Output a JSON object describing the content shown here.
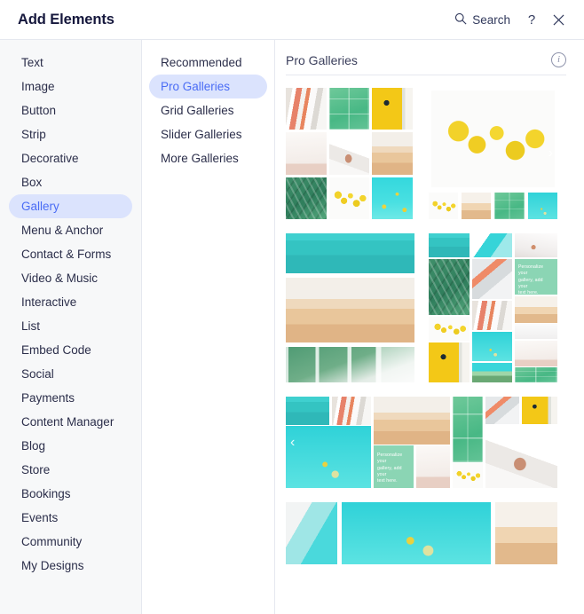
{
  "header": {
    "title": "Add Elements",
    "search_label": "Search",
    "search_icon": "search-icon",
    "help_label": "?",
    "close_label": "×"
  },
  "categories": [
    {
      "label": "Text",
      "selected": false
    },
    {
      "label": "Image",
      "selected": false
    },
    {
      "label": "Button",
      "selected": false
    },
    {
      "label": "Strip",
      "selected": false
    },
    {
      "label": "Decorative",
      "selected": false
    },
    {
      "label": "Box",
      "selected": false
    },
    {
      "label": "Gallery",
      "selected": true
    },
    {
      "label": "Menu & Anchor",
      "selected": false
    },
    {
      "label": "Contact & Forms",
      "selected": false
    },
    {
      "label": "Video & Music",
      "selected": false
    },
    {
      "label": "Interactive",
      "selected": false
    },
    {
      "label": "List",
      "selected": false
    },
    {
      "label": "Embed Code",
      "selected": false
    },
    {
      "label": "Social",
      "selected": false
    },
    {
      "label": "Payments",
      "selected": false
    },
    {
      "label": "Content Manager",
      "selected": false
    },
    {
      "label": "Blog",
      "selected": false
    },
    {
      "label": "Store",
      "selected": false
    },
    {
      "label": "Bookings",
      "selected": false
    },
    {
      "label": "Events",
      "selected": false
    },
    {
      "label": "Community",
      "selected": false
    },
    {
      "label": "My Designs",
      "selected": false
    }
  ],
  "subcategories": [
    {
      "label": "Recommended",
      "selected": false
    },
    {
      "label": "Pro Galleries",
      "selected": true
    },
    {
      "label": "Grid Galleries",
      "selected": false
    },
    {
      "label": "Slider Galleries",
      "selected": false
    },
    {
      "label": "More Galleries",
      "selected": false
    }
  ],
  "content": {
    "title": "Pro Galleries",
    "info_icon": "info-icon"
  },
  "galleries": [
    {
      "name": "grid-3x3-gallery",
      "layout": "half"
    },
    {
      "name": "slider-with-thumbnails-gallery",
      "layout": "half"
    },
    {
      "name": "stacked-rows-gallery",
      "layout": "half"
    },
    {
      "name": "masonry-columns-gallery",
      "layout": "half"
    },
    {
      "name": "wide-collage-gallery",
      "layout": "full"
    },
    {
      "name": "wide-strip-gallery",
      "layout": "full"
    }
  ],
  "placeholder_text": {
    "line1": "Personalize your",
    "line2": "gallery, add your",
    "line3": "text here."
  },
  "colors": {
    "accent": "#4a6cf5",
    "accent_pill": "#dbe3fd",
    "text": "#2b2e4a",
    "sidebar_bg": "#f7f8f9",
    "border": "#e5e8ef"
  }
}
